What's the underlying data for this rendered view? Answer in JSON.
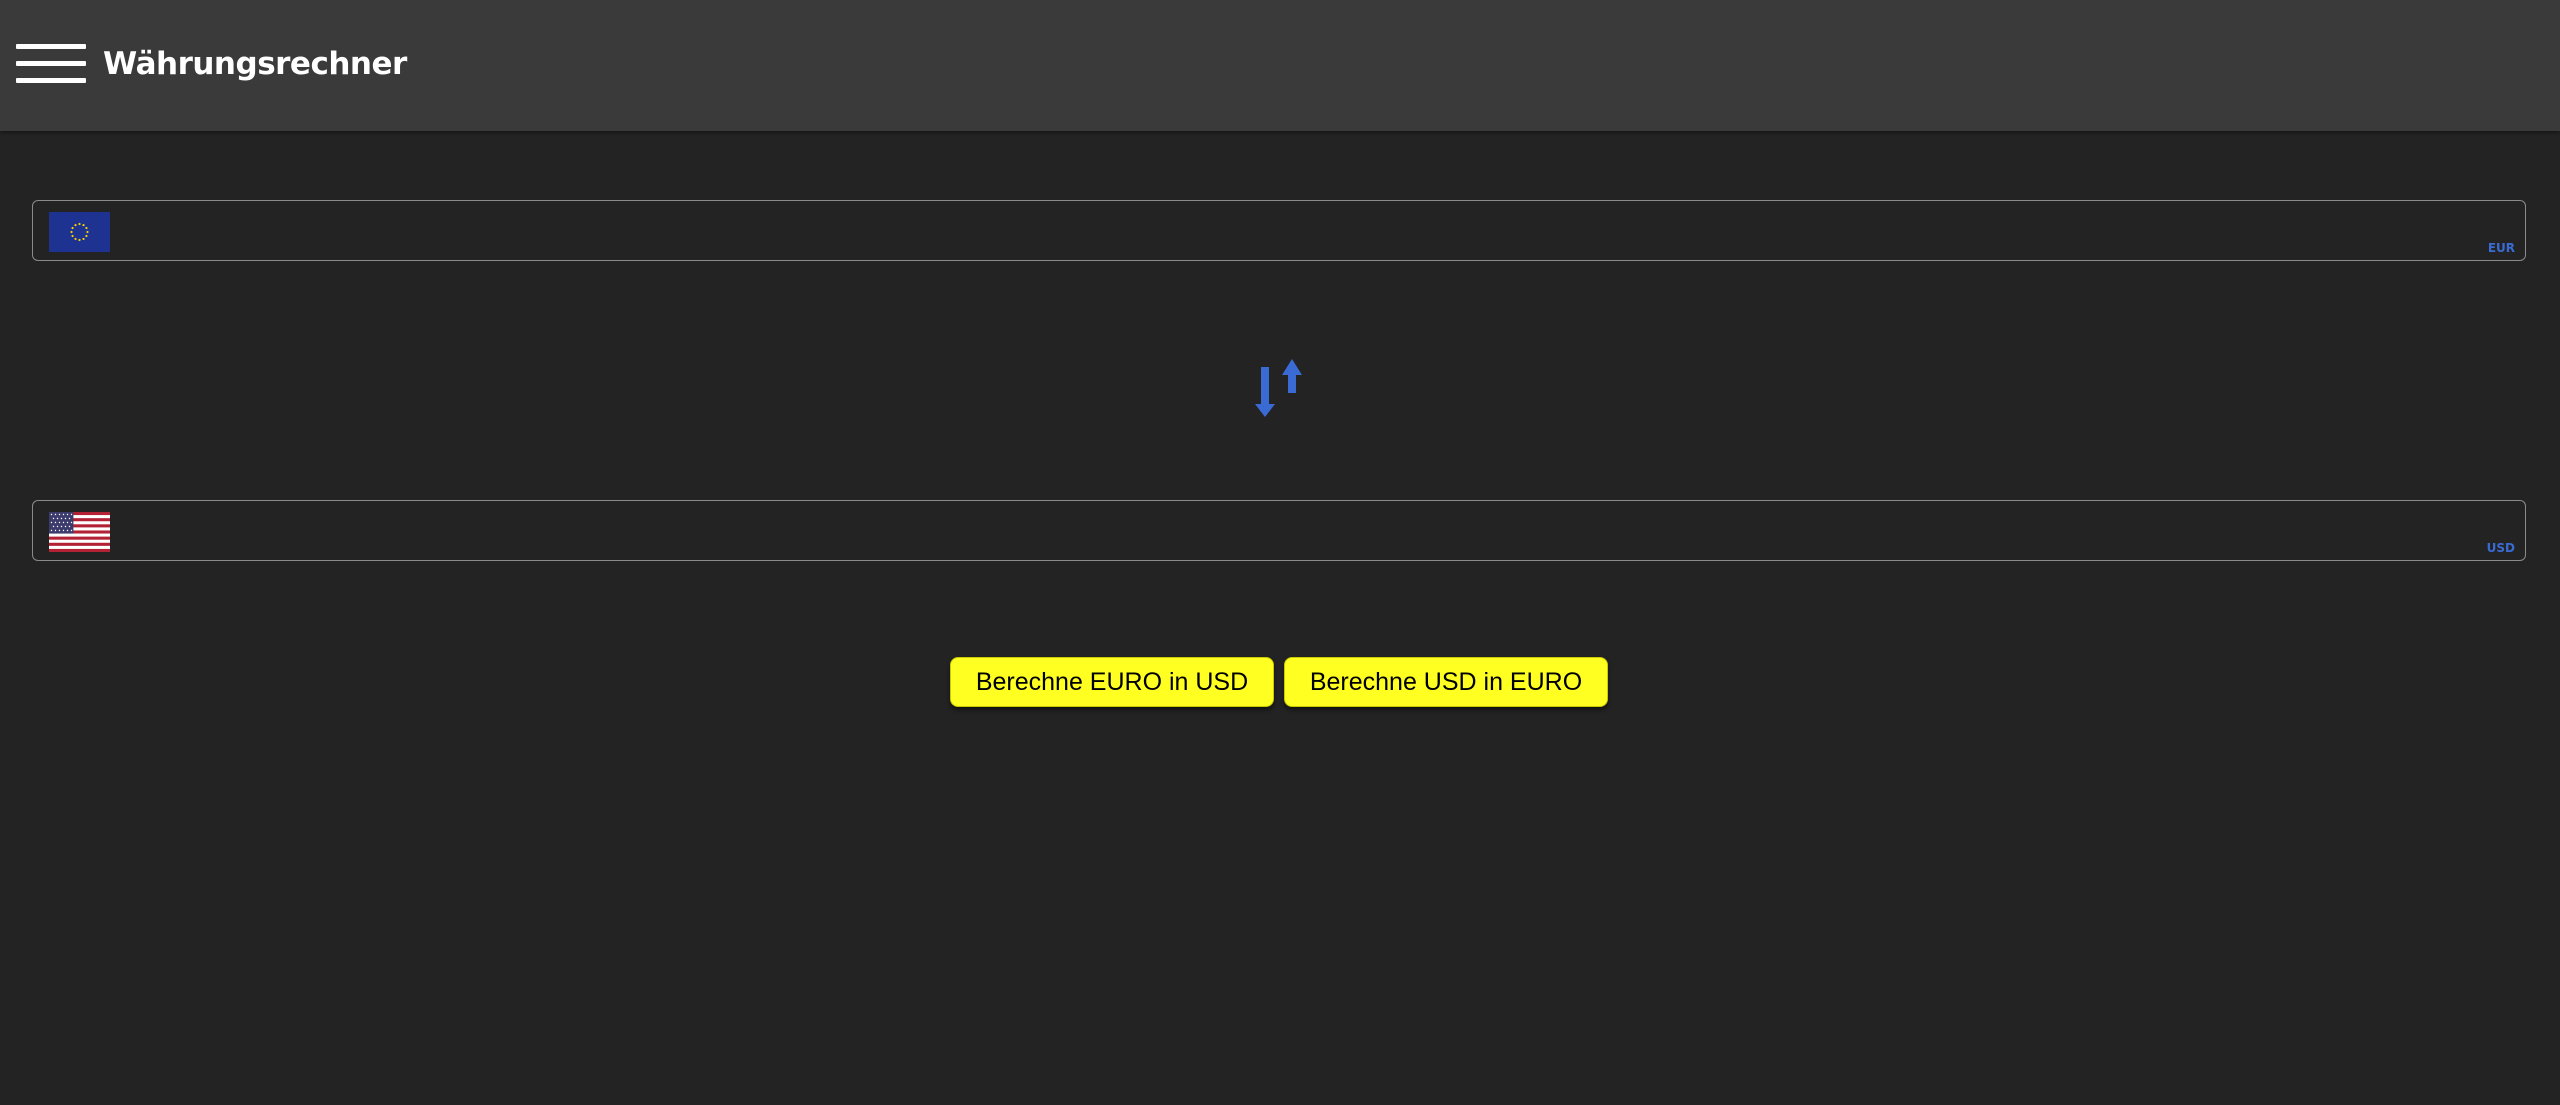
{
  "app_bar": {
    "title": "Währungsrechner",
    "menu_icon": "hamburger-menu-icon"
  },
  "fields": {
    "eur": {
      "value": "",
      "unit": "EUR",
      "flag_icon": "eu-flag-icon"
    },
    "usd": {
      "value": "",
      "unit": "USD",
      "flag_icon": "us-flag-icon"
    }
  },
  "swap": {
    "icon": "swap-vertical-arrows-icon"
  },
  "buttons": {
    "eur_to_usd": "Berechne EURO in USD",
    "usd_to_eur": "Berechne USD in EURO"
  },
  "colors": {
    "app_bar_background": "#3a3a3a",
    "page_background": "#232323",
    "accent_blue": "#3a6bd4",
    "button_yellow": "#ffff22"
  }
}
